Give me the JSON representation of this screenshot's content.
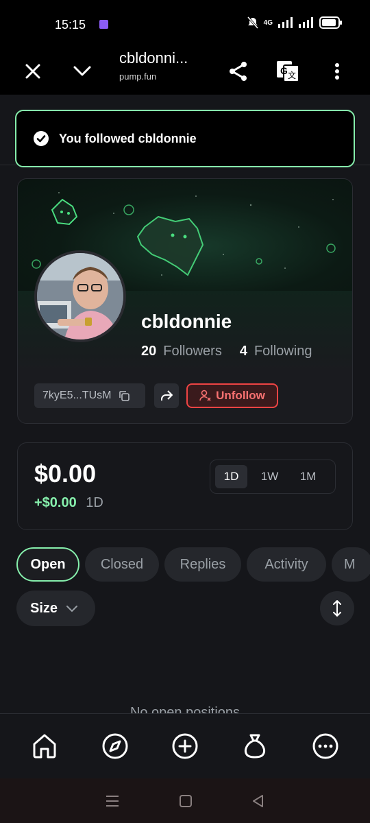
{
  "status_bar": {
    "time": "15:15",
    "network": "4G"
  },
  "browser": {
    "title": "cbldonni...",
    "url": "pump.fun"
  },
  "toast": {
    "message": "You followed cbldonnie"
  },
  "profile": {
    "username": "cbldonnie",
    "followers_count": "20",
    "followers_label": "Followers",
    "following_count": "4",
    "following_label": "Following",
    "address": "7kyE5...TUsM",
    "unfollow_label": "Unfollow"
  },
  "balance": {
    "value": "$0.00",
    "change": "+$0.00",
    "change_period": "1D",
    "periods": [
      "1D",
      "1W",
      "1M"
    ],
    "selected_period": "1D"
  },
  "tabs": [
    "Open",
    "Closed",
    "Replies",
    "Activity",
    "M"
  ],
  "active_tab": "Open",
  "filter": {
    "size_label": "Size"
  },
  "empty_state": {
    "text": "No open positions"
  },
  "colors": {
    "accent_green": "#86efac",
    "danger_red": "#ef4444",
    "background": "#15161a"
  }
}
